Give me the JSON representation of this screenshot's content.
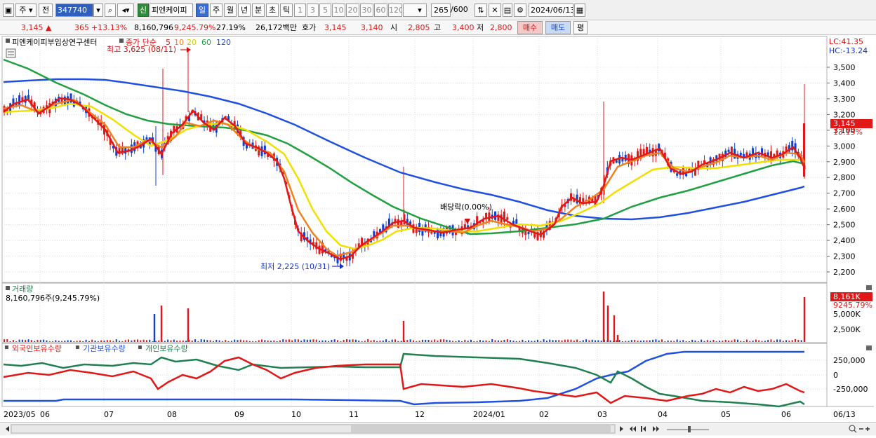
{
  "toolbar": {
    "mode_options": [
      "주",
      "전"
    ],
    "stock_code": "347740",
    "stock_name": "피엔케이피",
    "badge_new": "신",
    "period_tabs": [
      "일",
      "주",
      "월",
      "년",
      "분",
      "초",
      "틱"
    ],
    "active_period": "일",
    "interval_buttons": [
      "1",
      "3",
      "5",
      "10",
      "20",
      "30",
      "60",
      "120"
    ],
    "bar_count": "265",
    "bar_total": "/600",
    "date": "2024/06/13"
  },
  "quote": {
    "price": "3,145",
    "change": "365",
    "change_pct": "+13.13%",
    "volume": "8,160,796",
    "volume_pct": "9,245.79%",
    "turnover": "27.19%",
    "amount": "26,172백만",
    "bid_label": "호가",
    "ask": "3,145",
    "bid": "3,140",
    "open_label": "시",
    "open": "2,805",
    "high_label": "고",
    "high": "3,400",
    "low_label": "저",
    "low": "2,800",
    "buy_label": "매수",
    "sell_label": "매도",
    "eval_label": "평"
  },
  "price_panel": {
    "name": "피엔케이피부임상연구센터",
    "legend_title": "종가 단순",
    "ma_periods": [
      "5",
      "10",
      "20",
      "60",
      "120"
    ],
    "ma_colors": [
      "#e01818",
      "#f08020",
      "#f0e000",
      "#20a040",
      "#2050e0"
    ],
    "lc": "LC:41.35",
    "hc": "HC:-13.24",
    "high_annotation": "최고 3,625 (08/11)",
    "low_annotation": "최저 2,225 (10/31)",
    "dividend_annotation": "배당락(0.00%)",
    "current_price_tag": "3,145",
    "current_pct_tag": "13.13%",
    "y_ticks": [
      "3,500",
      "3,400",
      "3,300",
      "3,200",
      "3,100",
      "3,000",
      "2,900",
      "2,800",
      "2,700",
      "2,600",
      "2,500",
      "2,400",
      "2,300",
      "2,200"
    ]
  },
  "volume_panel": {
    "title": "거래량",
    "value_text": "8,160,796주(9,245.79%)",
    "current_tag": "8,161K",
    "current_pct": "9245.79%",
    "y_ticks": [
      "5,000K",
      "2,500K"
    ]
  },
  "holdings_panel": {
    "series": [
      "외국인보유수량",
      "기관보유수량",
      "개인보유수량"
    ],
    "series_colors": [
      "#e01818",
      "#2050e0",
      "#208050"
    ],
    "y_ticks": [
      "250,000",
      "0",
      "-250,000"
    ]
  },
  "x_axis": {
    "labels": [
      "2023/05",
      "06",
      "07",
      "08",
      "09",
      "10",
      "11",
      "12",
      "2024/01",
      "02",
      "03",
      "04",
      "05",
      "06"
    ],
    "current_label": "06/13"
  },
  "chart_data": {
    "type": "candlestick",
    "period": "2023/05 - 2024/06/13",
    "y_range": [
      2150,
      3650
    ],
    "key_points": [
      {
        "label": "high",
        "date": "08/11",
        "value": 3625
      },
      {
        "label": "low",
        "date": "10/31",
        "value": 2225
      },
      {
        "label": "last",
        "date": "06/13",
        "value": 3145,
        "open": 2805,
        "high": 3400,
        "low": 2800
      }
    ]
  }
}
